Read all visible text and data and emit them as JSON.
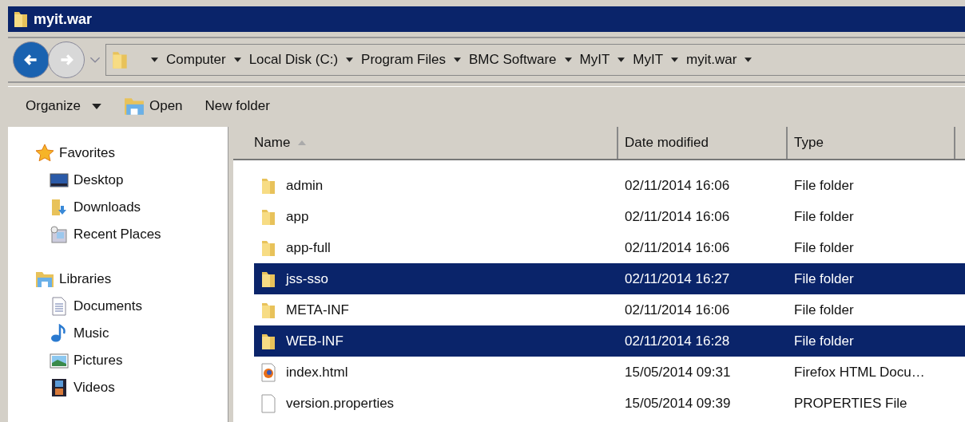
{
  "window": {
    "title": "myit.war"
  },
  "address": {
    "back_disabled": false,
    "forward_disabled": true,
    "crumbs": [
      "Computer",
      "Local Disk (C:)",
      "Program Files",
      "BMC Software",
      "MyIT",
      "MyIT",
      "myit.war"
    ]
  },
  "toolbar": [
    {
      "label": "Organize",
      "kind": "menu"
    },
    {
      "label": "Open",
      "kind": "open"
    },
    {
      "label": "New folder",
      "kind": "plain"
    }
  ],
  "sidebar": {
    "groups": [
      {
        "label": "Favorites",
        "kind": "star",
        "items": [
          {
            "label": "Desktop",
            "kind": "desktop"
          },
          {
            "label": "Downloads",
            "kind": "downloads"
          },
          {
            "label": "Recent Places",
            "kind": "recent"
          }
        ]
      },
      {
        "label": "Libraries",
        "kind": "library",
        "items": [
          {
            "label": "Documents",
            "kind": "documents"
          },
          {
            "label": "Music",
            "kind": "music"
          },
          {
            "label": "Pictures",
            "kind": "pictures"
          },
          {
            "label": "Videos",
            "kind": "videos"
          }
        ]
      }
    ]
  },
  "table": {
    "columns": [
      {
        "label": "Name",
        "sorted": true
      },
      {
        "label": "Date modified",
        "sorted": false
      },
      {
        "label": "Type",
        "sorted": false
      }
    ],
    "rows": [
      {
        "name": "admin",
        "kind": "folder",
        "date": "02/11/2014 16:06",
        "type": "File folder",
        "selected": false
      },
      {
        "name": "app",
        "kind": "folder",
        "date": "02/11/2014 16:06",
        "type": "File folder",
        "selected": false
      },
      {
        "name": "app-full",
        "kind": "folder",
        "date": "02/11/2014 16:06",
        "type": "File folder",
        "selected": false
      },
      {
        "name": "jss-sso",
        "kind": "folder",
        "date": "02/11/2014 16:27",
        "type": "File folder",
        "selected": true
      },
      {
        "name": "META-INF",
        "kind": "folder",
        "date": "02/11/2014 16:06",
        "type": "File folder",
        "selected": false
      },
      {
        "name": "WEB-INF",
        "kind": "folder",
        "date": "02/11/2014 16:28",
        "type": "File folder",
        "selected": true
      },
      {
        "name": "index.html",
        "kind": "firefox",
        "date": "15/05/2014 09:31",
        "type": "Firefox HTML Docu…",
        "selected": false
      },
      {
        "name": "version.properties",
        "kind": "file",
        "date": "15/05/2014 09:39",
        "type": "PROPERTIES File",
        "selected": false
      }
    ]
  }
}
